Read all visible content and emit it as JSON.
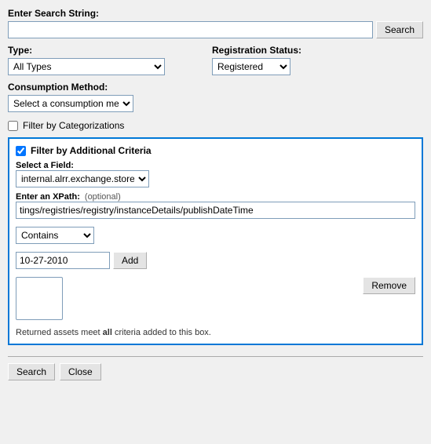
{
  "header": {
    "search_string_label": "Enter Search String:",
    "search_button_label": "Search"
  },
  "type_field": {
    "label": "Type:",
    "value": "All Types",
    "options": [
      "All Types"
    ]
  },
  "registration_status": {
    "label": "Registration Status:",
    "value": "Registered",
    "options": [
      "Registered"
    ]
  },
  "consumption_method": {
    "label": "Consumption Method:",
    "value": "Select a consumption method",
    "options": [
      "Select a consumption method"
    ]
  },
  "filter_categorizations": {
    "label": "Filter by Categorizations",
    "checked": false
  },
  "additional_criteria": {
    "title": "Filter by Additional Criteria",
    "checked": true,
    "select_field_label": "Select a Field:",
    "select_field_value": "internal.alrr.exchange.store",
    "xpath_label": "Enter an XPath:",
    "xpath_optional": "(optional)",
    "xpath_value": "tings/registries/registry/instanceDetails/publishDateTime",
    "contains_label": "Contains",
    "contains_options": [
      "Contains"
    ],
    "value_input": "10-27-2010",
    "add_button": "Add",
    "remove_button": "Remove",
    "note": "Returned assets meet ",
    "note_bold": "all",
    "note_end": " criteria added to this box."
  },
  "bottom_buttons": {
    "search_label": "Search",
    "close_label": "Close"
  }
}
